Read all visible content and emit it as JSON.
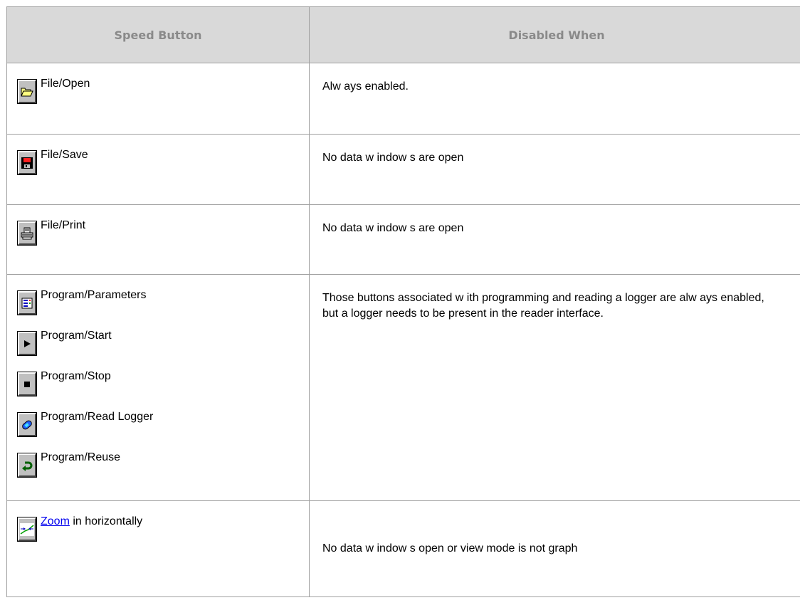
{
  "table": {
    "headers": {
      "speed_button": "Speed Button",
      "disabled_when": "Disabled When"
    },
    "rows": [
      {
        "buttons": [
          {
            "icon": "folder-open-icon",
            "label": "File/Open"
          }
        ],
        "disabled_when": "Alw ays enabled."
      },
      {
        "buttons": [
          {
            "icon": "floppy-disk-icon",
            "label": "File/Save"
          }
        ],
        "disabled_when": "No data w indow s are open"
      },
      {
        "buttons": [
          {
            "icon": "printer-icon",
            "label": "File/Print"
          }
        ],
        "disabled_when": "No data w indow s are open"
      },
      {
        "buttons": [
          {
            "icon": "parameters-icon",
            "label": "Program/Parameters"
          },
          {
            "icon": "play-icon",
            "label": "Program/Start"
          },
          {
            "icon": "stop-icon",
            "label": "Program/Stop"
          },
          {
            "icon": "read-logger-icon",
            "label": "Program/Read Logger"
          },
          {
            "icon": "reuse-arrow-icon",
            "label": "Program/Reuse"
          }
        ],
        "disabled_when": "Those buttons associated w ith programming and reading a logger are alw ays enabled, but a logger needs to be present in the reader interface."
      },
      {
        "buttons": [
          {
            "icon": "zoom-horizontal-icon",
            "link": "Zoom",
            "label": " in horizontally"
          }
        ],
        "disabled_when": "No data w indow s open or view  mode is not graph"
      }
    ]
  },
  "colors": {
    "header_bg": "#d9d9d9",
    "header_text": "#8a8a8a",
    "border": "#a0a0a0",
    "button_face": "#c0c0c0",
    "link": "#0000ee"
  }
}
